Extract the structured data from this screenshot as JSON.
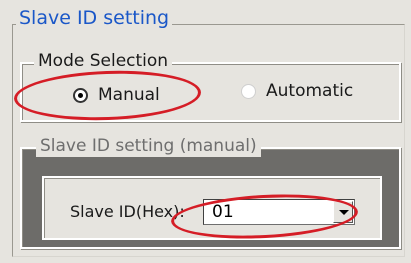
{
  "window": {
    "title": "Slave ID setting"
  },
  "mode_selection": {
    "title": "Mode Selection",
    "options": [
      {
        "label": "Manual",
        "selected": true
      },
      {
        "label": "Automatic",
        "selected": false
      }
    ]
  },
  "slave_id_manual": {
    "title": "Slave ID setting (manual)",
    "field_label": "Slave ID(Hex):",
    "value": "01"
  },
  "colors": {
    "title_blue": "#1a57c8",
    "highlight_red": "#d51d26",
    "panel_gray": "#e6e4df",
    "disabled_group": "#6d6c69"
  },
  "icons": [
    "radio-selected-icon",
    "radio-unselected-icon",
    "dropdown-arrow-icon"
  ]
}
